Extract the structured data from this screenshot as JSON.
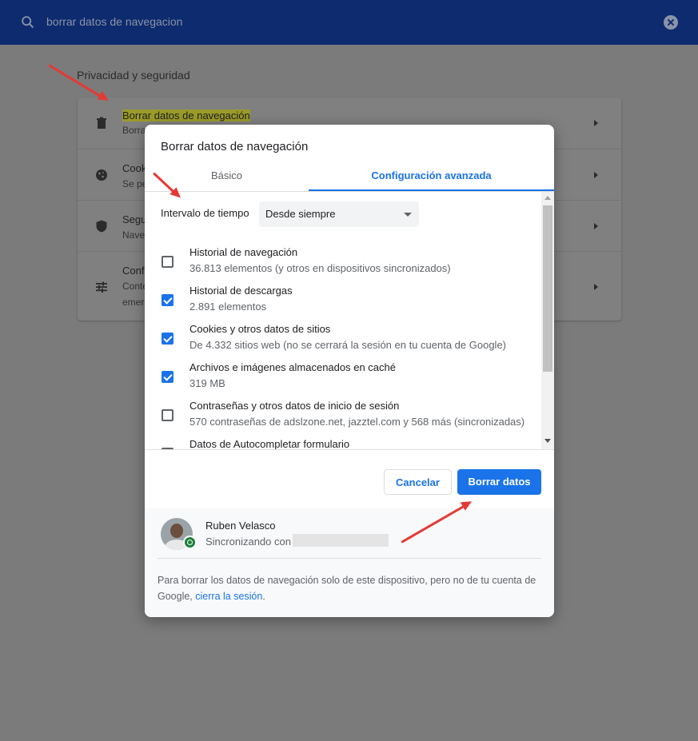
{
  "header": {
    "search_value": "borrar datos de navegacion"
  },
  "settings": {
    "section_title": "Privacidad y seguridad",
    "rows": [
      {
        "title": "Borrar datos de navegación",
        "subtitle": "Borra"
      },
      {
        "title": "Cook",
        "subtitle": "Se pe"
      },
      {
        "title": "Segu",
        "subtitle": "Nave"
      },
      {
        "title": "Confi",
        "subtitle": "Conte",
        "subtitle2": "emer"
      }
    ]
  },
  "dialog": {
    "title": "Borrar datos de navegación",
    "tabs": {
      "basic": "Básico",
      "advanced": "Configuración avanzada"
    },
    "time_range_label": "Intervalo de tiempo",
    "time_range_value": "Desde siempre",
    "items": [
      {
        "title": "Historial de navegación",
        "desc": "36.813 elementos (y otros en dispositivos sincronizados)",
        "checked": false
      },
      {
        "title": "Historial de descargas",
        "desc": "2.891 elementos",
        "checked": true
      },
      {
        "title": "Cookies y otros datos de sitios",
        "desc": "De 4.332 sitios web (no se cerrará la sesión en tu cuenta de Google)",
        "checked": true
      },
      {
        "title": "Archivos e imágenes almacenados en caché",
        "desc": "319 MB",
        "checked": true
      },
      {
        "title": "Contraseñas y otros datos de inicio de sesión",
        "desc": "570 contraseñas de adslzone.net, jazztel.com y 568 más (sincronizadas)",
        "checked": false
      },
      {
        "title": "Datos de Autocompletar formulario",
        "desc": "",
        "checked": false
      }
    ],
    "buttons": {
      "cancel": "Cancelar",
      "delete": "Borrar datos"
    },
    "account": {
      "name": "Ruben Velasco",
      "sync_text": "Sincronizando con"
    },
    "footer": {
      "text": "Para borrar los datos de navegación solo de este dispositivo, pero no de tu cuenta de Google,",
      "link": "cierra la sesión",
      "end": "."
    }
  },
  "colors": {
    "accent": "#1a73e8",
    "header": "#0d2b6e",
    "annotation": "#e53935",
    "sync": "#188038"
  },
  "icons": [
    "search-icon",
    "clear-icon",
    "trash-icon",
    "cookie-icon",
    "shield-icon",
    "tune-icon",
    "chevron-right-icon",
    "dropdown-caret-icon",
    "sync-icon"
  ]
}
